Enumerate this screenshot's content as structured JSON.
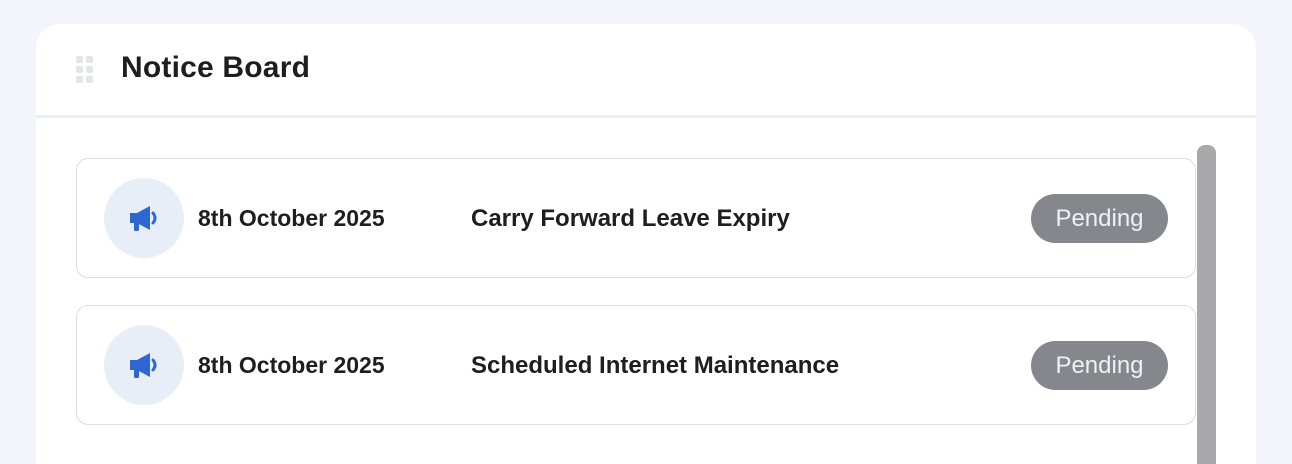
{
  "widget": {
    "title": "Notice Board",
    "drag_handle_icon": "drag-grip-icon"
  },
  "notices": [
    {
      "icon": "megaphone-icon",
      "date": "8th October 2025",
      "title": "Carry Forward Leave Expiry",
      "status": "Pending"
    },
    {
      "icon": "megaphone-icon",
      "date": "8th October 2025",
      "title": "Scheduled Internet Maintenance",
      "status": "Pending"
    }
  ],
  "colors": {
    "page_background": "#f4f5fa",
    "icon_accent": "#2e67d4",
    "icon_circle": "#e8eef8",
    "status_pending": "#86878c"
  }
}
